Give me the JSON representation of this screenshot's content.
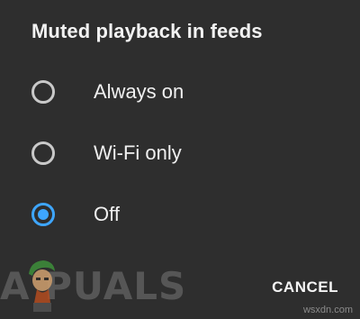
{
  "dialog": {
    "title": "Muted playback in feeds",
    "options": [
      {
        "label": "Always on",
        "selected": false
      },
      {
        "label": "Wi-Fi only",
        "selected": false
      },
      {
        "label": "Off",
        "selected": true
      }
    ],
    "cancel_label": "CANCEL"
  },
  "watermark": {
    "text": "A  PUALS",
    "site": "wsxdn.com"
  },
  "colors": {
    "background": "#2e2e2e",
    "accent": "#3ea6ff",
    "radio_unchecked": "#c9c9c9",
    "text": "#f0f0f0"
  }
}
